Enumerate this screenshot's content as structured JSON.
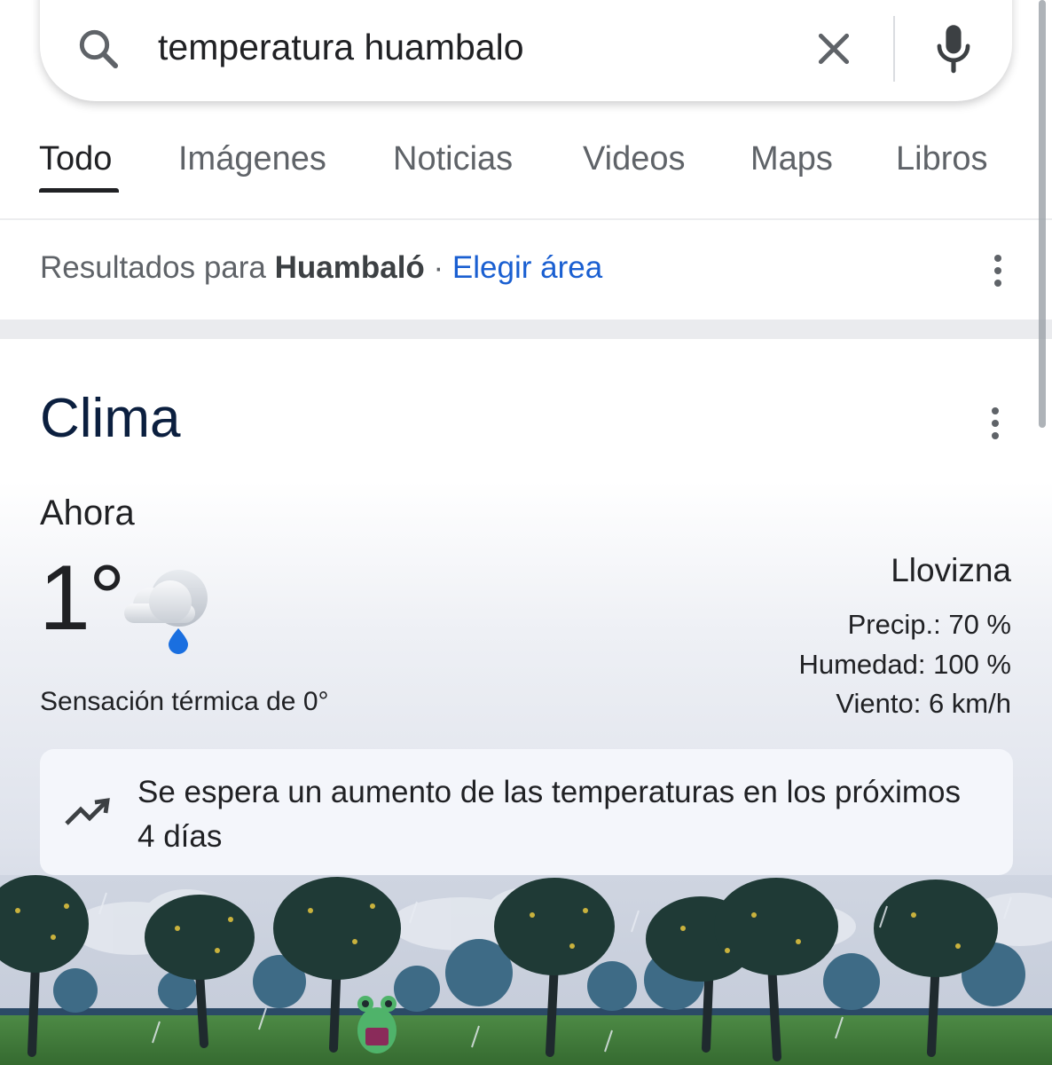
{
  "search": {
    "query": "temperatura huambalo"
  },
  "tabs": [
    {
      "label": "Todo",
      "active": true
    },
    {
      "label": "Imágenes"
    },
    {
      "label": "Noticias"
    },
    {
      "label": "Videos"
    },
    {
      "label": "Maps"
    },
    {
      "label": "Libros"
    }
  ],
  "location": {
    "prefix": "Resultados para ",
    "place": "Huambaló",
    "separator": " · ",
    "link": "Elegir área"
  },
  "weather": {
    "title": "Clima",
    "now_label": "Ahora",
    "temperature": "1°",
    "feels_like": "Sensación térmica de 0°",
    "condition": "Llovizna",
    "precip": "Precip.: 70 %",
    "humidity": "Humedad: 100 %",
    "wind": "Viento: 6 km/h",
    "icon": "cloud-drizzle-icon",
    "trend_icon": "trending-up-icon",
    "trend_text": "Se espera un aumento de las temperaturas en los próximos 4 días"
  },
  "colors": {
    "link": "#1a5fd1",
    "title": "#0b1f3f",
    "raindrop": "#1a6fe0",
    "grass": "#3f7d3a"
  }
}
